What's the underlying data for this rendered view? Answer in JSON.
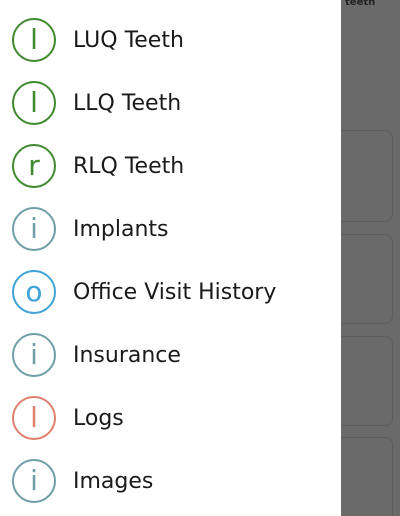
{
  "background": {
    "header_text": "teeth"
  },
  "menu": {
    "items": [
      {
        "label": "LUQ Teeth",
        "icon_letter": "l",
        "icon": "letter-l-icon",
        "color": "#3f8a2f"
      },
      {
        "label": "LLQ Teeth",
        "icon_letter": "l",
        "icon": "letter-l-icon",
        "color": "#3f8a2f"
      },
      {
        "label": "RLQ Teeth",
        "icon_letter": "r",
        "icon": "letter-r-icon",
        "color": "#3f8a2f"
      },
      {
        "label": "Implants",
        "icon_letter": "i",
        "icon": "info-icon",
        "color": "#6f9ea8"
      },
      {
        "label": "Office Visit History",
        "icon_letter": "o",
        "icon": "letter-o-icon",
        "color": "#3ea3d6"
      },
      {
        "label": "Insurance",
        "icon_letter": "i",
        "icon": "info-icon",
        "color": "#6f9ea8"
      },
      {
        "label": "Logs",
        "icon_letter": "l",
        "icon": "letter-l-icon",
        "color": "#e07f6e"
      },
      {
        "label": "Images",
        "icon_letter": "i",
        "icon": "info-icon",
        "color": "#6f9ea8"
      }
    ]
  }
}
